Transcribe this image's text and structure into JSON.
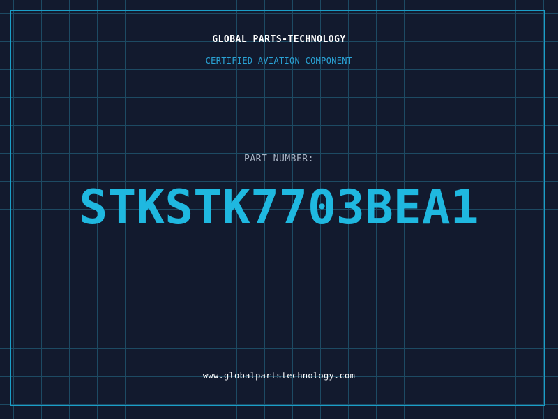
{
  "header": {
    "company": "GLOBAL PARTS-TECHNOLOGY",
    "subtitle": "CERTIFIED AVIATION COMPONENT"
  },
  "part": {
    "label": "PART NUMBER:",
    "number": "STKSTK7703BEA1"
  },
  "footer": {
    "website": "www.globalpartstechnology.com"
  },
  "colors": {
    "background": "#121a2e",
    "grid": "#1d4a63",
    "accent": "#1fb8e0",
    "frame": "#1a9ec7"
  }
}
